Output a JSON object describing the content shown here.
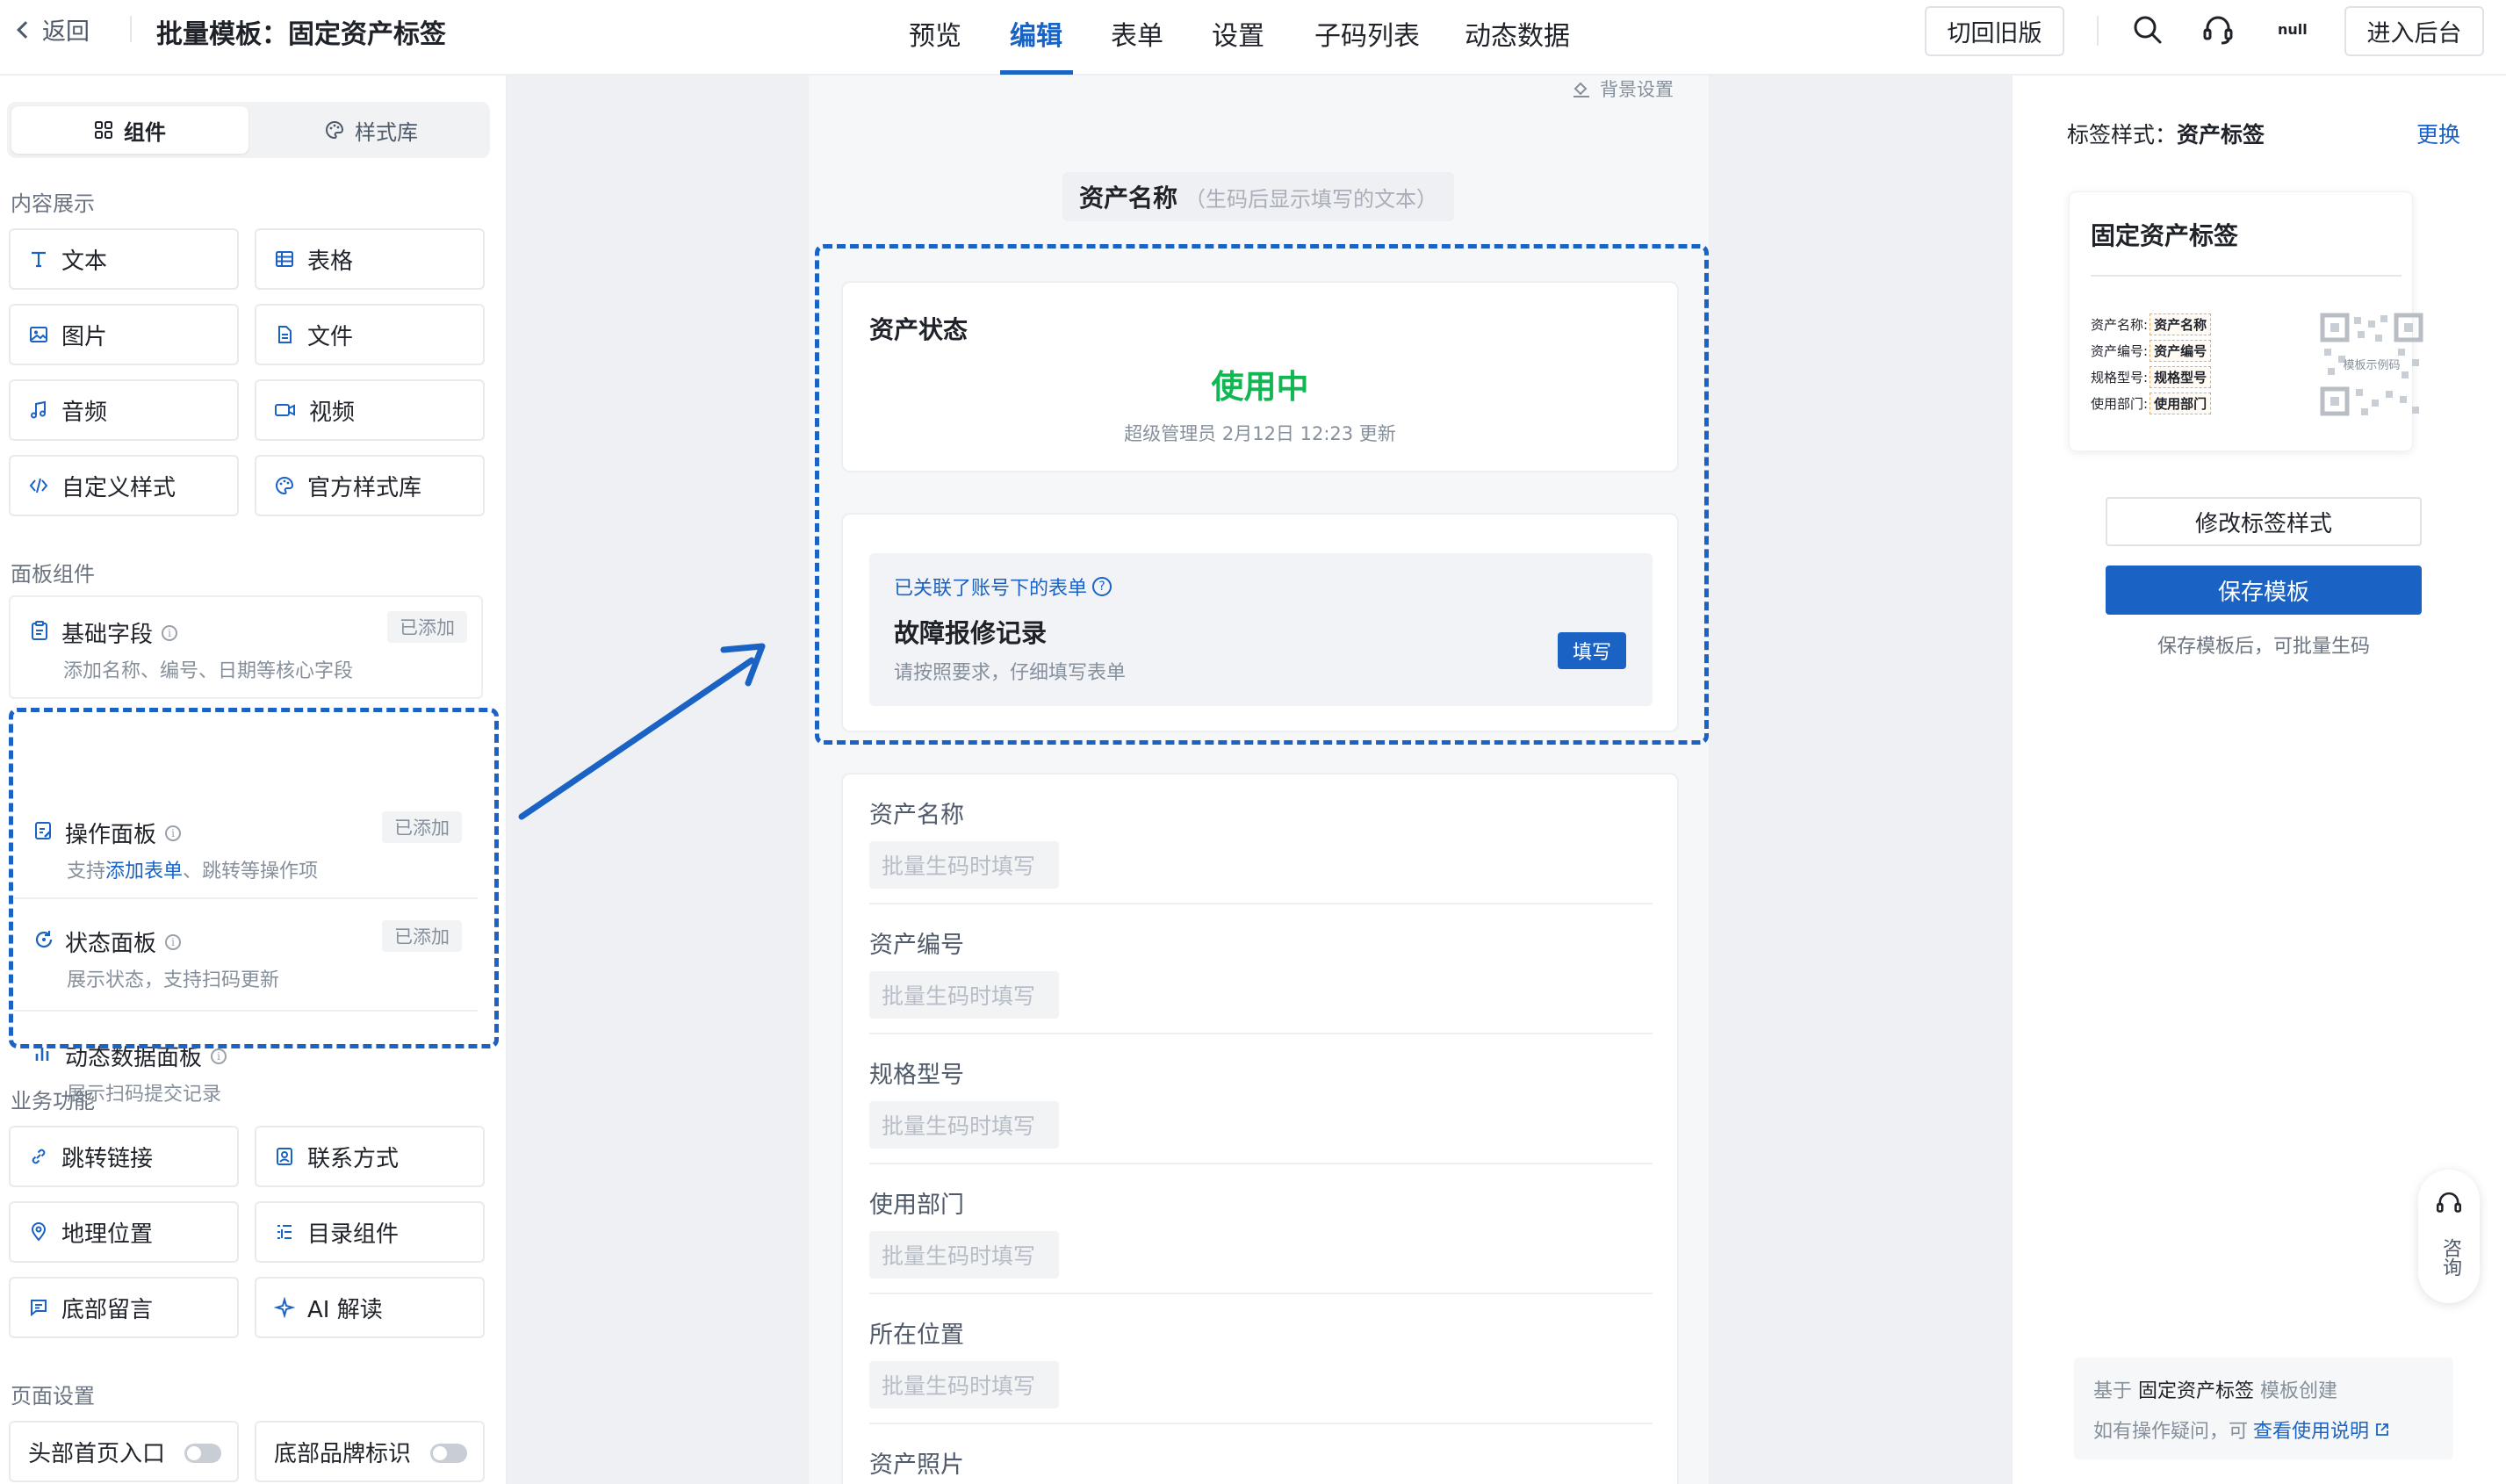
{
  "topbar": {
    "back_label": "返回",
    "title": "批量模板：固定资产标签",
    "tabs": [
      "预览",
      "编辑",
      "表单",
      "设置",
      "子码列表",
      "动态数据"
    ],
    "active_tab": "编辑",
    "old_version_label": "切回旧版",
    "avatar_text": "null",
    "admin_label": "进入后台"
  },
  "sidebar": {
    "seg_components": "组件",
    "seg_styles": "样式库",
    "section_content": "内容展示",
    "content_tiles": [
      {
        "label": "文本",
        "icon": "text-icon"
      },
      {
        "label": "表格",
        "icon": "table-icon"
      },
      {
        "label": "图片",
        "icon": "image-icon"
      },
      {
        "label": "文件",
        "icon": "file-icon"
      },
      {
        "label": "音频",
        "icon": "audio-icon"
      },
      {
        "label": "视频",
        "icon": "video-icon"
      },
      {
        "label": "自定义样式",
        "icon": "code-icon"
      },
      {
        "label": "官方样式库",
        "icon": "palette-icon"
      }
    ],
    "section_panels": "面板组件",
    "panels": [
      {
        "title": "基础字段",
        "desc": "添加名称、编号、日期等核心字段",
        "badge": "已添加"
      },
      {
        "title": "操作面板",
        "desc_pre": "支持",
        "desc_link": "添加表单",
        "desc_post": "、跳转等操作项",
        "badge": "已添加"
      },
      {
        "title": "状态面板",
        "desc": "展示状态，支持扫码更新",
        "badge": "已添加"
      },
      {
        "title": "动态数据面板",
        "desc": "展示扫码提交记录"
      }
    ],
    "section_business": "业务功能",
    "business_tiles": [
      {
        "label": "跳转链接",
        "icon": "link-icon"
      },
      {
        "label": "联系方式",
        "icon": "contact-icon"
      },
      {
        "label": "地理位置",
        "icon": "location-icon"
      },
      {
        "label": "目录组件",
        "icon": "catalog-icon"
      },
      {
        "label": "底部留言",
        "icon": "comment-icon"
      },
      {
        "label": "AI 解读",
        "icon": "sparkle-icon"
      }
    ],
    "section_page": "页面设置",
    "page_toggles": [
      {
        "label": "头部首页入口",
        "on": false
      },
      {
        "label": "底部品牌标识",
        "on": false
      }
    ]
  },
  "canvas": {
    "bg_setting": "背景设置",
    "title_main": "资产名称",
    "title_hint": "（生码后显示填写的文本）",
    "status_heading": "资产状态",
    "status_value": "使用中",
    "status_value_color": "#12b652",
    "status_meta": "超级管理员 2月12日 12:23 更新",
    "linked_label": "已关联了账号下的表单",
    "linked_title": "故障报修记录",
    "linked_sub": "请按照要求，仔细填写表单",
    "fill_label": "填写",
    "fields": [
      {
        "label": "资产名称",
        "placeholder": "批量生码时填写"
      },
      {
        "label": "资产编号",
        "placeholder": "批量生码时填写"
      },
      {
        "label": "规格型号",
        "placeholder": "批量生码时填写"
      },
      {
        "label": "使用部门",
        "placeholder": "批量生码时填写"
      },
      {
        "label": "所在位置",
        "placeholder": "批量生码时填写"
      },
      {
        "label": "资产照片"
      }
    ]
  },
  "rpanel": {
    "style_prefix": "标签样式：",
    "style_name": "资产标签",
    "change_label": "更换",
    "tag_title": "固定资产标签",
    "tag_rows": [
      {
        "k": "资产名称:",
        "v": "资产名称"
      },
      {
        "k": "资产编号:",
        "v": "资产编号"
      },
      {
        "k": "规格型号:",
        "v": "规格型号"
      },
      {
        "k": "使用部门:",
        "v": "使用部门"
      }
    ],
    "qr_caption": "模板示例码",
    "modify_label": "修改标签样式",
    "save_label": "保存模板",
    "save_hint": "保存模板后，可批量生码",
    "consult_label": "咨询",
    "foot_pre": "基于",
    "foot_name": "固定资产标签",
    "foot_post": "模板创建",
    "foot_q": "如有操作疑问，可",
    "foot_link": "查看使用说明"
  },
  "colors": {
    "accent": "#1a63c4",
    "success": "#12b652"
  }
}
